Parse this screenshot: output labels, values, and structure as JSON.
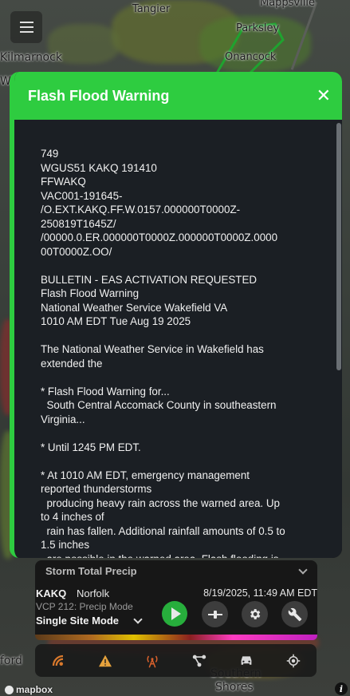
{
  "map": {
    "labels": {
      "tangier": "Tangier",
      "mappsville": "Mappsville",
      "kilmarnock": "Kilmarnock",
      "parksley": "Parksley",
      "onancock": "Onancock",
      "whc": "Wh",
      "ford": "ford",
      "southern_shores_1": "Southern",
      "southern_shores_2": "Shores"
    },
    "attribution": "mapbox"
  },
  "warning": {
    "title": "Flash Flood Warning",
    "close_label": "✕",
    "accent_color": "#2ecc40",
    "bulletin": "749\nWGUS51 KAKQ 191410\nFFWAKQ\nVAC001-191645-\n/O.EXT.KAKQ.FF.W.0157.000000T0000Z-\n250819T1645Z/\n/00000.0.ER.000000T0000Z.000000T0000Z.0000\n00T0000Z.OO/\n\nBULLETIN - EAS ACTIVATION REQUESTED\nFlash Flood Warning\nNational Weather Service Wakefield VA\n1010 AM EDT Tue Aug 19 2025\n\nThe National Weather Service in Wakefield has\nextended the\n\n* Flash Flood Warning for...\n  South Central Accomack County in southeastern\nVirginia...\n\n* Until 1245 PM EDT.\n\n* At 1010 AM EDT, emergency management\nreported thunderstorms\n  producing heavy rain across the warned area. Up\nto 4 inches of\n  rain has fallen. Additional rainfall amounts of 0.5 to\n1.5 inches\n  are possible in the warned area. Flash flooding is"
  },
  "radar_panel": {
    "product": "Storm Total Precip",
    "site_code": "KAKQ",
    "site_name": "Norfolk",
    "timestamp": "8/19/2025, 11:49 AM EDT",
    "vcp": "VCP 212: Precip Mode",
    "mode": "Single Site Mode"
  },
  "toolbar": {
    "icons": [
      "radar-sweep-icon",
      "warning-icon",
      "tower-icon",
      "network-icon",
      "car-icon",
      "crosshair-icon"
    ]
  },
  "info_label": "i"
}
